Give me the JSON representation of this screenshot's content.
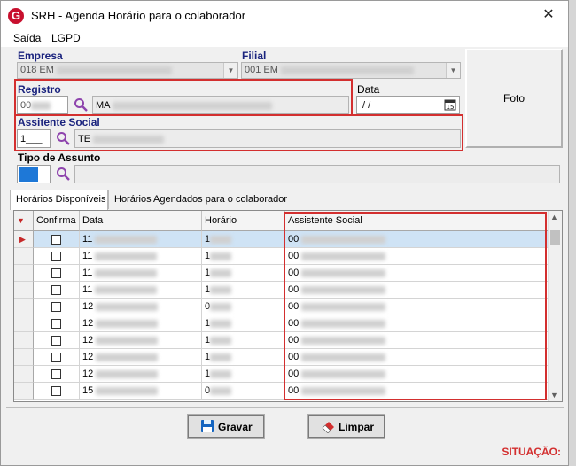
{
  "window": {
    "title": "SRH - Agenda Horário para o colaborador",
    "close_glyph": "✕"
  },
  "menu": [
    "Saída",
    "LGPD"
  ],
  "empresa": {
    "label": "Empresa",
    "value": "018 EM"
  },
  "filial": {
    "label": "Filial",
    "value": "001 EM"
  },
  "registro": {
    "label": "Registro",
    "code": "00",
    "name": "MA"
  },
  "data": {
    "label": "Data",
    "value": " /  /"
  },
  "foto": {
    "label": "Foto"
  },
  "assistente": {
    "label": "Assitente Social",
    "code": "1___",
    "name": "TE"
  },
  "tipo_assunto": {
    "label": "Tipo de Assunto"
  },
  "tabs": [
    "Horários Disponíveis",
    "Horários Agendados para o colaborador"
  ],
  "grid": {
    "headers": [
      "Confirma",
      "Data",
      "Horário",
      "Assistente Social"
    ],
    "rows": [
      {
        "data": "11",
        "horario": "1",
        "assistente": "00"
      },
      {
        "data": "11",
        "horario": "1",
        "assistente": "00"
      },
      {
        "data": "11",
        "horario": "1",
        "assistente": "00"
      },
      {
        "data": "11",
        "horario": "1",
        "assistente": "00"
      },
      {
        "data": "12",
        "horario": "0",
        "assistente": "00"
      },
      {
        "data": "12",
        "horario": "1",
        "assistente": "00"
      },
      {
        "data": "12",
        "horario": "1",
        "assistente": "00"
      },
      {
        "data": "12",
        "horario": "1",
        "assistente": "00"
      },
      {
        "data": "12",
        "horario": "1",
        "assistente": "00"
      },
      {
        "data": "15",
        "horario": "0",
        "assistente": "00"
      }
    ]
  },
  "buttons": {
    "gravar": "Gravar",
    "limpar": "Limpar"
  },
  "status": {
    "situacao": "SITUAÇÃO:"
  },
  "colors": {
    "highlight": "#d32f2f",
    "label_blue": "#1a237e",
    "selection": "#cfe3f5"
  }
}
